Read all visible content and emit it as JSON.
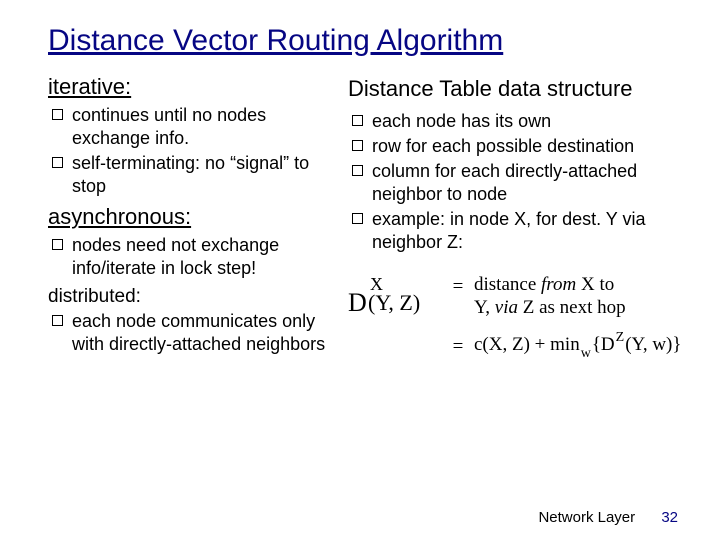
{
  "title": "Distance Vector Routing Algorithm",
  "left": {
    "heading1": "iterative:",
    "items1": [
      "continues until no nodes exchange info.",
      "self-terminating: no “signal” to stop"
    ],
    "heading2": "asynchronous:",
    "items2": [
      "nodes need not exchange info/iterate in lock step!"
    ],
    "heading3": "distributed:",
    "items3": [
      "each node communicates only with directly-attached neighbors"
    ]
  },
  "right": {
    "heading": "Distance Table data structure",
    "items": [
      "each node has its own",
      "row for each possible destination",
      "column for each directly-attached neighbor to node",
      "example: in node X, for dest. Y via neighbor Z:"
    ],
    "formula": {
      "lhs_D": "D",
      "lhs_sup": "X",
      "lhs_args": "(Y, Z)",
      "eq": "=",
      "rhs1_a": "distance ",
      "rhs1_b": "from",
      "rhs1_c": " X to",
      "rhs1_d": "Y, ",
      "rhs1_e": "via",
      "rhs1_f": " Z as next hop",
      "rhs2_a": "c(X, Z) + min",
      "rhs2_subw": "w",
      "rhs2_b": "{D",
      "rhs2_supZ": "Z",
      "rhs2_c": "(Y, w)}"
    }
  },
  "footer": {
    "section": "Network Layer",
    "page": "32"
  }
}
